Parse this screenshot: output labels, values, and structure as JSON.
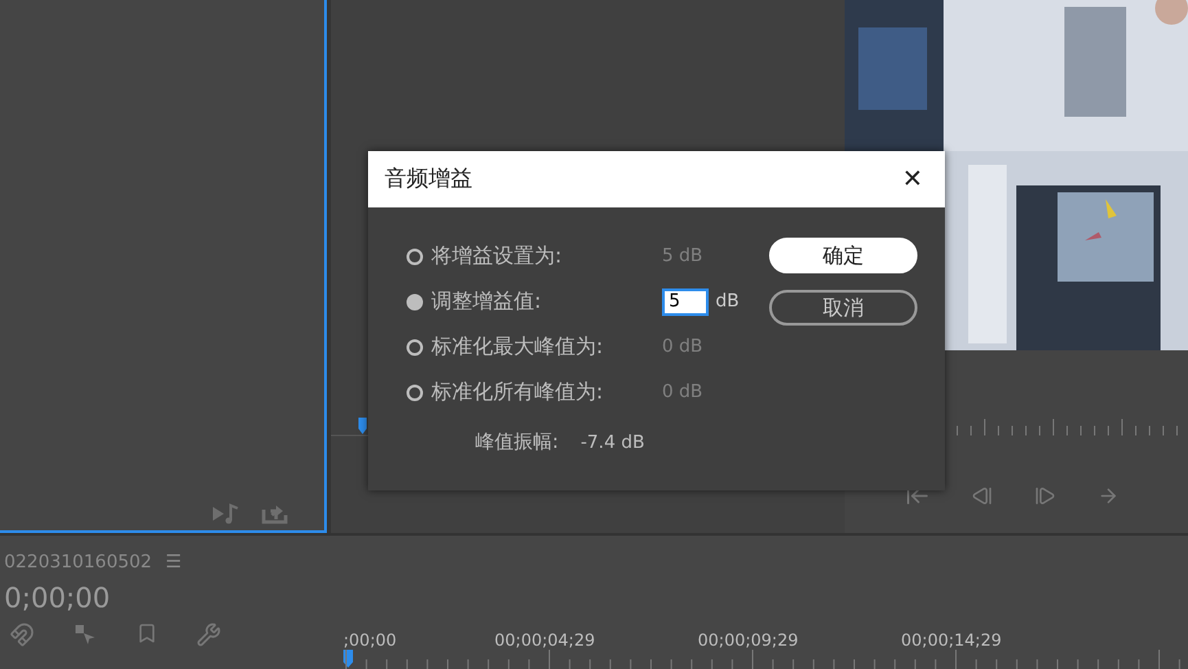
{
  "sequence": {
    "name": "0220310160502",
    "menu": "☰",
    "timecode": "0;00;00"
  },
  "ruler": {
    "timecodes": [
      ";00;00",
      "00;00;04;29",
      "00;00;09;29",
      "00;00;14;29"
    ]
  },
  "dialog": {
    "title": "音频增益",
    "close": "✕",
    "options": [
      {
        "kind": "readout",
        "label": "将增益设置为:",
        "value": "5 dB",
        "selected": false
      },
      {
        "kind": "input",
        "label": "调整增益值:",
        "value": "5",
        "unit": "dB",
        "selected": true
      },
      {
        "kind": "readout",
        "label": "标准化最大峰值为:",
        "value": "0 dB",
        "selected": false
      },
      {
        "kind": "readout",
        "label": "标准化所有峰值为:",
        "value": "0 dB",
        "selected": false
      }
    ],
    "peak": {
      "label": "峰值振幅:",
      "value": "-7.4 dB"
    },
    "buttons": [
      {
        "kind": "primary",
        "label": "确定"
      },
      {
        "kind": "secondary",
        "label": "取消"
      }
    ]
  }
}
